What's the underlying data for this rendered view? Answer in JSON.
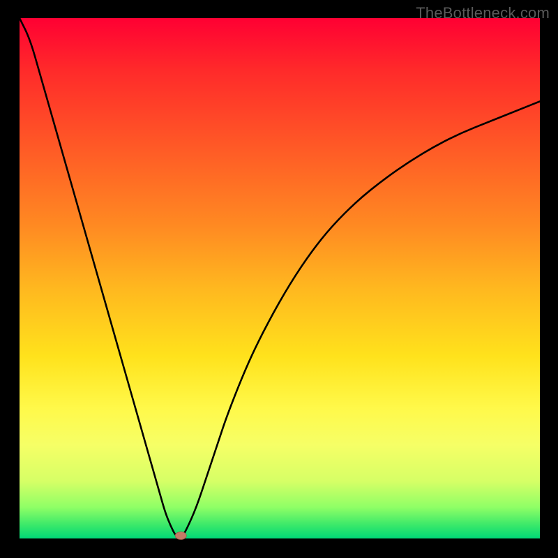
{
  "watermark": "TheBottleneck.com",
  "colors": {
    "gradient_stops": [
      {
        "offset": 0,
        "hex": "#ff0033"
      },
      {
        "offset": 10,
        "hex": "#ff2a2a"
      },
      {
        "offset": 25,
        "hex": "#ff5a26"
      },
      {
        "offset": 40,
        "hex": "#ff8a22"
      },
      {
        "offset": 52,
        "hex": "#ffb81f"
      },
      {
        "offset": 65,
        "hex": "#ffe21c"
      },
      {
        "offset": 75,
        "hex": "#fff94a"
      },
      {
        "offset": 82,
        "hex": "#f6ff66"
      },
      {
        "offset": 89,
        "hex": "#d6ff66"
      },
      {
        "offset": 94,
        "hex": "#8fff66"
      },
      {
        "offset": 97.5,
        "hex": "#38e86a"
      },
      {
        "offset": 100,
        "hex": "#00d877"
      }
    ],
    "curve": "#000000",
    "marker": "#c47a66",
    "frame": "#000000"
  },
  "chart_data": {
    "type": "line",
    "title": "",
    "xlabel": "",
    "ylabel": "",
    "xlim": [
      0,
      100
    ],
    "ylim": [
      0,
      100
    ],
    "grid": false,
    "legend_position": "none",
    "annotations": [
      {
        "text": "TheBottleneck.com",
        "role": "watermark",
        "position": "top-right"
      }
    ],
    "x": [
      0,
      2,
      4,
      6,
      8,
      10,
      12,
      14,
      16,
      18,
      20,
      22,
      24,
      26,
      27,
      28,
      29,
      30,
      31,
      32,
      34,
      36,
      38,
      40,
      44,
      48,
      52,
      56,
      60,
      65,
      70,
      75,
      80,
      85,
      90,
      95,
      100
    ],
    "values": [
      100,
      96,
      89,
      82,
      75,
      68,
      61,
      54,
      47,
      40,
      33,
      26,
      19,
      12,
      8.5,
      5,
      2.5,
      0.5,
      0,
      1.5,
      6,
      12,
      18,
      24,
      34,
      42,
      49,
      55,
      60,
      65,
      69,
      72.5,
      75.5,
      78,
      80,
      82,
      84
    ],
    "series": [
      {
        "name": "bottleneck-curve",
        "x_key": "x",
        "y_key": "values"
      }
    ],
    "marker": {
      "x": 31,
      "y": 0,
      "shape": "oval",
      "color": "#c47a66"
    }
  }
}
